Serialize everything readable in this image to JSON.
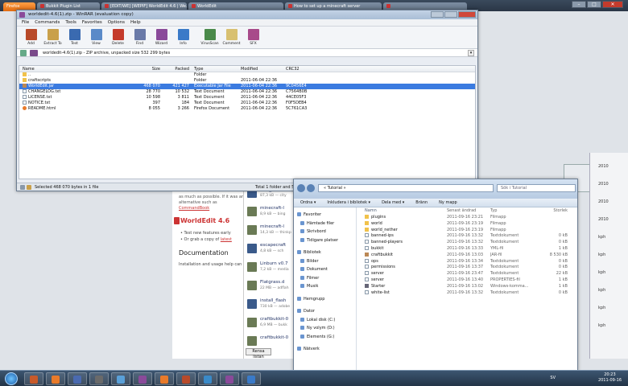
{
  "browser": {
    "tabs": [
      {
        "label": "Firefox",
        "cls": "firefox"
      },
      {
        "label": "Bukkit Plugin List",
        "cls": "w1"
      },
      {
        "label": "[EDIT/WE] [WEPIF] WorldEdit 4.6 | We...",
        "cls": "w2"
      },
      {
        "label": "WorldEdit",
        "cls": "w3"
      },
      {
        "label": "How to set up a minecraft server",
        "cls": "w4"
      },
      {
        "label": "",
        "cls": "w5"
      }
    ]
  },
  "webpage": {
    "note_text": "as much as possible. If it was an alternative such as",
    "note_link": "CommandBook",
    "worldedit_heading": "WorldEdit 4.6",
    "bullet1": "Test new features early",
    "bullet2": "Or grab a copy of",
    "bullet2_link": "latest",
    "documentation_heading": "Documentation",
    "documentation_line": "Installation and usage help can"
  },
  "downloads": {
    "items": [
      {
        "name": "new_minecraft",
        "size": "87,3 kB — city"
      },
      {
        "name": "minecraft-l",
        "size": "8,9 kB — bing"
      },
      {
        "name": "minecraft-l",
        "size": "14,3 kB — thinkp"
      },
      {
        "name": "escapecraft",
        "size": "4,8 kB — sch"
      },
      {
        "name": "Linburn v0.7",
        "size": "7,2 kB — media"
      },
      {
        "name": "Flatgrass.d",
        "size": "22 MB — adflah"
      },
      {
        "name": "install_flash",
        "size": "730 kB — adobe"
      },
      {
        "name": "craftbukkit-0",
        "size": "6,9 MB — bukk"
      },
      {
        "name": "craftbukkit-0",
        "size": ""
      }
    ],
    "clear_label": "Rensa listan"
  },
  "right_column": [
    "2010",
    "2010",
    "2010",
    "2010",
    "kph",
    "kph",
    "kph",
    "kph",
    "kph",
    "kph"
  ],
  "winrar": {
    "title": "worldedit-4.6(1).zip - WinRAR (evaluation copy)",
    "menu": [
      "File",
      "Commands",
      "Tools",
      "Favorites",
      "Options",
      "Help"
    ],
    "toolbar": [
      {
        "label": "Add",
        "color": "#b84a2a"
      },
      {
        "label": "Extract To",
        "color": "#c9a04a"
      },
      {
        "label": "Test",
        "color": "#3a6ab0"
      },
      {
        "label": "View",
        "color": "#5a8ac8"
      },
      {
        "label": "Delete",
        "color": "#c43b2c"
      },
      {
        "label": "Find",
        "color": "#6a7aa8"
      },
      {
        "label": "Wizard",
        "color": "#8a4a9a"
      },
      {
        "label": "Info",
        "color": "#3a7ac8"
      },
      {
        "label": "VirusScan",
        "color": "#4a8a4a"
      },
      {
        "label": "Comment",
        "color": "#d8c070"
      },
      {
        "label": "SFX",
        "color": "#a84a8a"
      }
    ],
    "path": "worldedit-4.6(1).zip - ZIP archive, unpacked size 532 299 bytes",
    "columns": {
      "name": "Name",
      "size": "Size",
      "packed": "Packed",
      "type": "Type",
      "modified": "Modified",
      "crc": "CRC32"
    },
    "rows": [
      {
        "name": "..",
        "size": "",
        "packed": "",
        "type": "Folder",
        "modified": "",
        "crc": "",
        "icon": "folder",
        "selected": false
      },
      {
        "name": "craftscripts",
        "size": "",
        "packed": "",
        "type": "Folder",
        "modified": "2011-06-04 22:36",
        "crc": "",
        "icon": "folder",
        "selected": false
      },
      {
        "name": "WorldEdit.jar",
        "size": "468 070",
        "packed": "421 427",
        "type": "Executable Jar File",
        "modified": "2011-06-04 22:36",
        "crc": "9C0456E4",
        "icon": "jar",
        "selected": true
      },
      {
        "name": "CHANGELOG.txt",
        "size": "28 770",
        "packed": "10 532",
        "type": "Text Document",
        "modified": "2011-06-04 22:36",
        "crc": "C7564B0B",
        "icon": "doc",
        "selected": false
      },
      {
        "name": "LICENSE.txt",
        "size": "10 598",
        "packed": "3 811",
        "type": "Text Document",
        "modified": "2011-06-04 22:36",
        "crc": "44CE05F3",
        "icon": "doc",
        "selected": false
      },
      {
        "name": "NOTICE.txt",
        "size": "397",
        "packed": "184",
        "type": "Text Document",
        "modified": "2011-06-04 22:36",
        "crc": "F0F5DEB4",
        "icon": "doc",
        "selected": false
      },
      {
        "name": "README.html",
        "size": "8 055",
        "packed": "3 266",
        "type": "Firefox Document",
        "modified": "2011-06-04 22:36",
        "crc": "5C761CA3",
        "icon": "ff",
        "selected": false
      }
    ],
    "status_left": "Selected 468 070 bytes in 1 file",
    "status_right": "Total 1 folder and 516 789 bytes in 5 files"
  },
  "explorer": {
    "address": "« Tutorial »",
    "search_placeholder": "Sök i Tutorial",
    "commands": [
      "Ordna ▾",
      "Inkludera i bibliotek ▾",
      "Dela med ▾",
      "Bränn",
      "Ny mapp"
    ],
    "nav": [
      {
        "label": "Favoriter",
        "header": true
      },
      {
        "label": "Hämtade filer",
        "header": false
      },
      {
        "label": "Skrivbord",
        "header": false
      },
      {
        "label": "Tidigare platser",
        "header": false
      },
      {
        "label": "Bibliotek",
        "header": true
      },
      {
        "label": "Bilder",
        "header": false
      },
      {
        "label": "Dokument",
        "header": false
      },
      {
        "label": "Filmer",
        "header": false
      },
      {
        "label": "Musik",
        "header": false
      },
      {
        "label": "Hemgrupp",
        "header": true
      },
      {
        "label": "Dator",
        "header": true
      },
      {
        "label": "Lokal disk (C:)",
        "header": false
      },
      {
        "label": "Ny volym (D:)",
        "header": false
      },
      {
        "label": "Elements (G:)",
        "header": false
      },
      {
        "label": "Nätverk",
        "header": true
      }
    ],
    "columns": {
      "name": "Namn",
      "date": "Senast ändrad",
      "type": "Typ",
      "size": "Storlek"
    },
    "rows": [
      {
        "name": "plugins",
        "date": "2011-09-16 23:21",
        "type": "Filmapp",
        "size": "",
        "icon": "folder"
      },
      {
        "name": "world",
        "date": "2011-09-16 23:19",
        "type": "Filmapp",
        "size": "",
        "icon": "folder"
      },
      {
        "name": "world_nether",
        "date": "2011-09-16 23:19",
        "type": "Filmapp",
        "size": "",
        "icon": "folder"
      },
      {
        "name": "banned-ips",
        "date": "2011-09-16 13:32",
        "type": "Textdokument",
        "size": "0 kB",
        "icon": "doc"
      },
      {
        "name": "banned-players",
        "date": "2011-09-16 13:32",
        "type": "Textdokument",
        "size": "0 kB",
        "icon": "doc"
      },
      {
        "name": "bukkit",
        "date": "2011-09-16 13:33",
        "type": "YML-fil",
        "size": "1 kB",
        "icon": "doc"
      },
      {
        "name": "craftbukkit",
        "date": "2011-09-16 13:03",
        "type": "JAR-fil",
        "size": "8 530 kB",
        "icon": "jar"
      },
      {
        "name": "ops",
        "date": "2011-09-16 13:34",
        "type": "Textdokument",
        "size": "0 kB",
        "icon": "doc"
      },
      {
        "name": "permissions",
        "date": "2011-09-16 13:37",
        "type": "Textdokument",
        "size": "0 kB",
        "icon": "doc"
      },
      {
        "name": "server",
        "date": "2011-09-16 23:47",
        "type": "Textdokument",
        "size": "22 kB",
        "icon": "doc"
      },
      {
        "name": "server",
        "date": "2011-09-16 13:40",
        "type": "PROPERTIES-fil",
        "size": "1 kB",
        "icon": "doc"
      },
      {
        "name": "Starter",
        "date": "2011-09-16 13:02",
        "type": "Windows-komma...",
        "size": "1 kB",
        "icon": "bat"
      },
      {
        "name": "white-list",
        "date": "2011-09-16 13:32",
        "type": "Textdokument",
        "size": "0 kB",
        "icon": "doc"
      }
    ]
  },
  "taskbar": {
    "items": [
      {
        "color": "#c85a2a"
      },
      {
        "color": "#e87a2a"
      },
      {
        "color": "#4a6ab0"
      },
      {
        "color": "#6a6a6a"
      },
      {
        "color": "#5aa0d8"
      },
      {
        "color": "#8a4a9a"
      },
      {
        "color": "#e87a2a"
      },
      {
        "color": "#b84a2a"
      },
      {
        "color": "#3a8ac8"
      },
      {
        "color": "#8a4a9a"
      },
      {
        "color": "#3a7ac8"
      }
    ],
    "language": "SV",
    "time": "20:23",
    "date": "2011-09-16"
  }
}
